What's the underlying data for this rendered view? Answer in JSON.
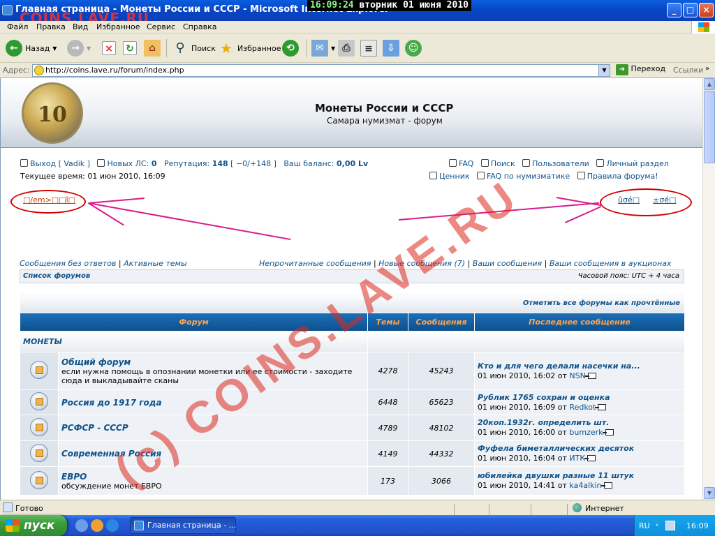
{
  "window": {
    "title": "Главная страница - Монеты России и СССР - Microsoft Internet Explorer",
    "clock_time": "16:09:24",
    "clock_date": "вторник 01 июня 2010",
    "watermark_top": "COINS.LAVE.RU",
    "buttons": {
      "minimize": "_",
      "maximize": "□",
      "close": "×"
    }
  },
  "menu": [
    "Файл",
    "Правка",
    "Вид",
    "Избранное",
    "Сервис",
    "Справка"
  ],
  "toolbar": {
    "back": "Назад",
    "search": "Поиск",
    "favorites": "Избранное"
  },
  "address": {
    "label": "Адрес:",
    "url": "http://coins.lave.ru/forum/index.php",
    "go": "Переход",
    "links": "Ссылки"
  },
  "site": {
    "coin_value": "10",
    "title": "Монеты России и СССР",
    "subtitle": "Самара нумизмат - форум"
  },
  "user": {
    "logout": "Выход [ Vadik ]",
    "new_pm_label": "Новых ЛС:",
    "new_pm": "0",
    "rep_label": "Репутация:",
    "rep": "148",
    "rep_detail": "[ −0/+148 ]",
    "balance_label": "Ваш баланс:",
    "balance": "0,00 Lv",
    "time": "Текущее время: 01 июн 2010, 16:09"
  },
  "links": {
    "faq": "FAQ",
    "search": "Поиск",
    "users": "Пользователи",
    "personal": "Личный раздел",
    "price": "Ценник",
    "faq_numis": "FAQ по нумизматике",
    "rules": "Правила форума!"
  },
  "garbled": {
    "left": "□/em>□□î□",
    "right1": "ûσé□",
    "right2": "±σé□"
  },
  "nav": {
    "no_answers": "Сообщения без ответов",
    "active": "Активные темы",
    "unread": "Непрочитанные сообщения",
    "new_posts": "Новые сообщения (7)",
    "your_posts": "Ваши сообщения",
    "auction_posts": "Ваши сообщения в аукционах",
    "sep": "|"
  },
  "crumb": {
    "forum_list": "Список форумов",
    "timezone": "Часовой пояс: UTC + 4 часа"
  },
  "table": {
    "mark_read": "Отметить все форумы как прочтённые",
    "headers": [
      "Форум",
      "Темы",
      "Сообщения",
      "Последнее сообщение"
    ],
    "category": "МОНЕТЫ",
    "rows": [
      {
        "name": "Общий форум",
        "desc": "если нужна помощь в опознании монетки или ее стоимости - заходите сюда и выкладывайте сканы",
        "topics": "4278",
        "posts": "45243",
        "last_title": "Кто и для чего делали насечки на...",
        "last_date": "01 июн 2010, 16:02 от",
        "last_user": "NSN"
      },
      {
        "name": "Россия до 1917 года",
        "desc": "",
        "topics": "6448",
        "posts": "65623",
        "last_title": "Рублик 1765 сохран и оценка",
        "last_date": "01 июн 2010, 16:09 от",
        "last_user": "Redkot"
      },
      {
        "name": "РСФСР - СССР",
        "desc": "",
        "topics": "4789",
        "posts": "48102",
        "last_title": "20коп.1932г. определить шт.",
        "last_date": "01 июн 2010, 16:00 от",
        "last_user": "bumzerk"
      },
      {
        "name": "Современная Россия",
        "desc": "",
        "topics": "4149",
        "posts": "44332",
        "last_title": "Фуфела биметаллических десяток",
        "last_date": "01 июн 2010, 16:04 от",
        "last_user": "ИТК"
      },
      {
        "name": "ЕВРО",
        "desc": "обсуждение монет ЕВРО",
        "topics": "173",
        "posts": "3066",
        "last_title": "юбилейка двушки разные 11 штук",
        "last_date": "01 июн 2010, 14:41 от",
        "last_user": "ka4alkin"
      }
    ]
  },
  "watermark": "(c) COINS.LAVE.RU",
  "status": {
    "done": "Готово",
    "zone": "Интернет"
  },
  "taskbar": {
    "start": "пуск",
    "task": "Главная страница - ...",
    "lang": "RU",
    "time": "16:09"
  },
  "colors": {
    "link": "#105289",
    "header_bar": "#1b6fb8",
    "header_text": "#ffa34f",
    "annotation": "#d00000",
    "arrow": "#d81b8c"
  }
}
